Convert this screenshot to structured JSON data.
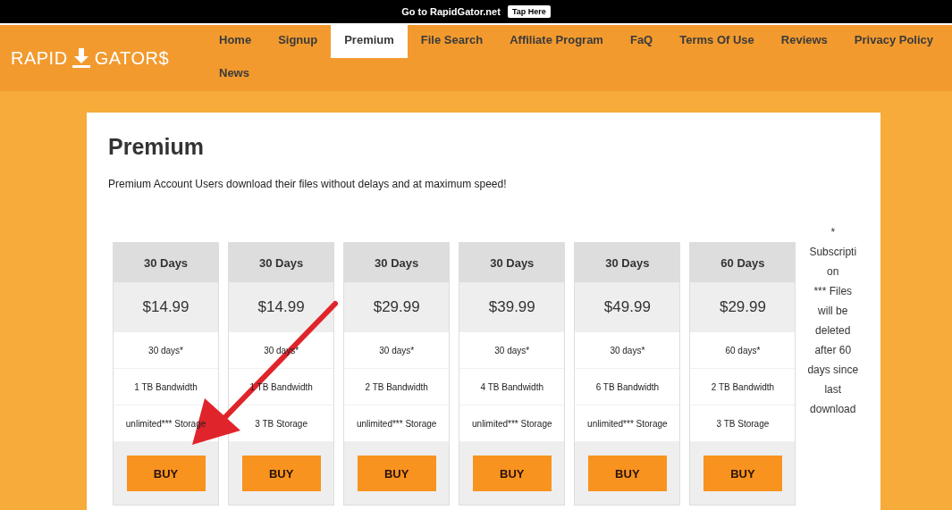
{
  "top_bar": {
    "text": "Go to RapidGator.net",
    "button": "Tap Here"
  },
  "logo": {
    "left": "RAPID",
    "right": "GATOR$"
  },
  "nav": [
    {
      "label": "Home",
      "selected": false
    },
    {
      "label": "Signup",
      "selected": false
    },
    {
      "label": "Premium",
      "selected": true
    },
    {
      "label": "File Search",
      "selected": false
    },
    {
      "label": "Affiliate Program",
      "selected": false
    },
    {
      "label": "FaQ",
      "selected": false
    },
    {
      "label": "Terms Of Use",
      "selected": false
    },
    {
      "label": "Reviews",
      "selected": false
    },
    {
      "label": "Privacy Policy",
      "selected": false
    },
    {
      "label": "News",
      "selected": false
    }
  ],
  "page": {
    "title": "Premium",
    "intro": "Premium Account Users download their files without delays and at maximum speed!"
  },
  "plans": [
    {
      "period": "30 Days",
      "price": "$14.99",
      "duration": "30 days*",
      "bandwidth": "1 TB Bandwidth",
      "storage": "unlimited*** Storage",
      "button": "BUY"
    },
    {
      "period": "30 Days",
      "price": "$14.99",
      "duration": "30 days*",
      "bandwidth": "1 TB Bandwidth",
      "storage": "3 TB Storage",
      "button": "BUY"
    },
    {
      "period": "30 Days",
      "price": "$29.99",
      "duration": "30 days*",
      "bandwidth": "2 TB Bandwidth",
      "storage": "unlimited*** Storage",
      "button": "BUY"
    },
    {
      "period": "30 Days",
      "price": "$39.99",
      "duration": "30 days*",
      "bandwidth": "4 TB Bandwidth",
      "storage": "unlimited*** Storage",
      "button": "BUY"
    },
    {
      "period": "30 Days",
      "price": "$49.99",
      "duration": "30 days*",
      "bandwidth": "6 TB Bandwidth",
      "storage": "unlimited*** Storage",
      "button": "BUY"
    },
    {
      "period": "60 Days",
      "price": "$29.99",
      "duration": "60 days*",
      "bandwidth": "2 TB Bandwidth",
      "storage": "3 TB Storage",
      "button": "BUY"
    }
  ],
  "footnotes": [
    "* Subscription",
    "*** Files will be deleted after 60 days since last download"
  ]
}
